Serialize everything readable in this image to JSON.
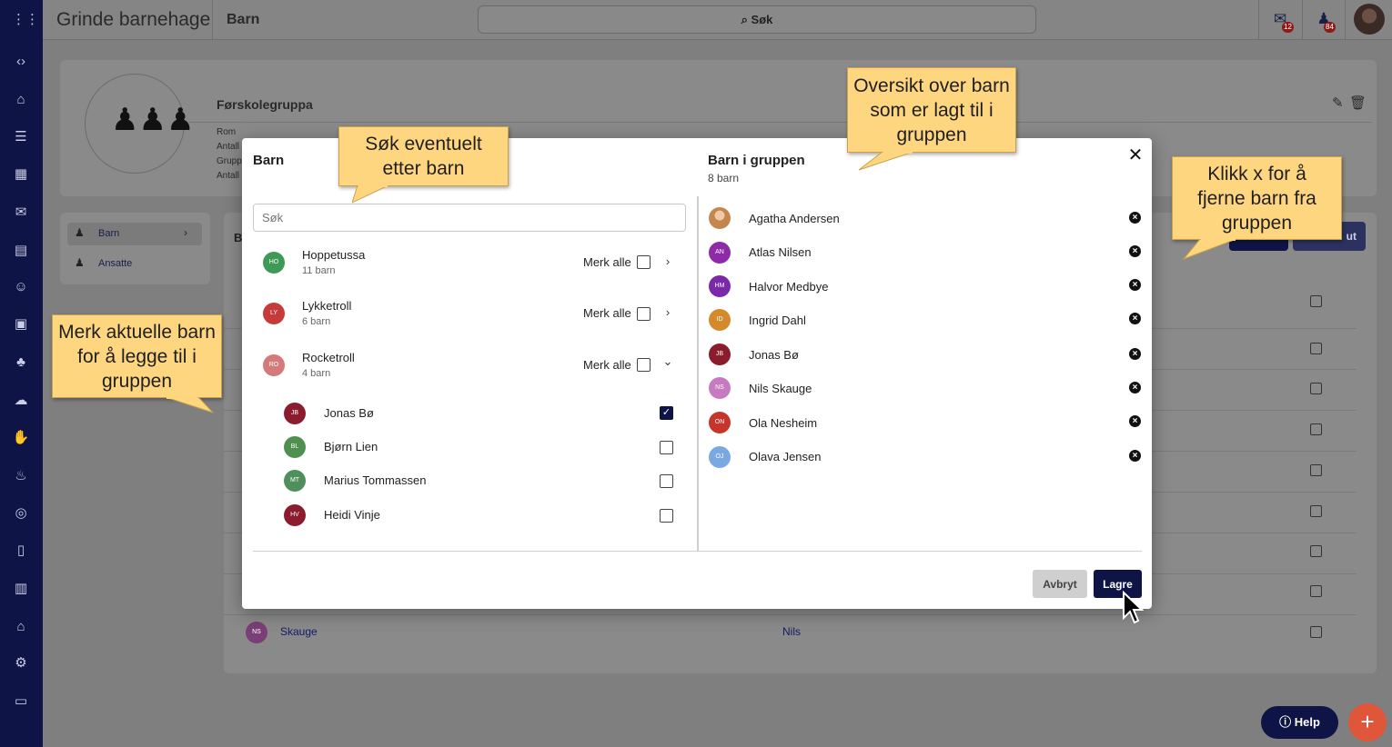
{
  "app": {
    "title": "Grinde barnehage",
    "page_title": "Barn",
    "search_label": "Søk",
    "mail_badge": "12",
    "bell_badge": "84"
  },
  "background": {
    "group_name": "Førskolegruppa",
    "info_labels": [
      "Rom",
      "Antall",
      "Grupp",
      "Antall"
    ],
    "side_menu": [
      {
        "label": "Barn"
      },
      {
        "label": "Ansatte"
      }
    ],
    "table_header_letter": "B",
    "button_partial": "ut",
    "last_row": {
      "initials": "NS",
      "last_name": "Skauge",
      "first_name": "Nils"
    }
  },
  "modal": {
    "left_title": "Barn",
    "search_placeholder": "Søk",
    "right_title": "Barn i gruppen",
    "right_count": "8 barn",
    "close_label": "✕",
    "groups": [
      {
        "initials": "HO",
        "name": "Hoppetussa",
        "count": "11 barn",
        "merk": "Merk alle",
        "color": "#3f9a57",
        "expanded": false
      },
      {
        "initials": "LY",
        "name": "Lykketroll",
        "count": "6 barn",
        "merk": "Merk alle",
        "color": "#c73a3a",
        "expanded": false
      },
      {
        "initials": "RO",
        "name": "Rocketroll",
        "count": "4 barn",
        "merk": "Merk alle",
        "color": "#d47a7a",
        "expanded": true
      }
    ],
    "group_children": [
      {
        "initials": "JB",
        "name": "Jonas Bø",
        "color": "#8a1c2e",
        "checked": true
      },
      {
        "initials": "BL",
        "name": "Bjørn Lien",
        "color": "#4f8f4f",
        "checked": false
      },
      {
        "initials": "MT",
        "name": "Marius Tommassen",
        "color": "#4f8f5c",
        "checked": false
      },
      {
        "initials": "HV",
        "name": "Heidi Vinje",
        "color": "#8a1c2e",
        "checked": false
      }
    ],
    "members": [
      {
        "initials": "",
        "name": "Agatha Andersen",
        "color": "#d9a27a",
        "photo": true
      },
      {
        "initials": "AN",
        "name": "Atlas Nilsen",
        "color": "#8e2aa8"
      },
      {
        "initials": "HM",
        "name": "Halvor Medbye",
        "color": "#7a2aa8"
      },
      {
        "initials": "ID",
        "name": "Ingrid Dahl",
        "color": "#d48a2a"
      },
      {
        "initials": "JB",
        "name": "Jonas Bø",
        "color": "#8a1c2e"
      },
      {
        "initials": "NS",
        "name": "Nils Skauge",
        "color": "#c77ac0"
      },
      {
        "initials": "ON",
        "name": "Ola Nesheim",
        "color": "#c7352a"
      },
      {
        "initials": "OJ",
        "name": "Olava Jensen",
        "color": "#7aa8e0"
      }
    ],
    "cancel_label": "Avbryt",
    "save_label": "Lagre"
  },
  "callouts": {
    "search": "Søk eventuelt etter barn",
    "overview": "Oversikt over barn som er lagt til i gruppen",
    "remove": "Klikk x for å fjerne barn fra gruppen",
    "mark": "Merk aktuelle barn for å legge til i gruppen"
  },
  "help_label": "Help",
  "fab_label": "+"
}
